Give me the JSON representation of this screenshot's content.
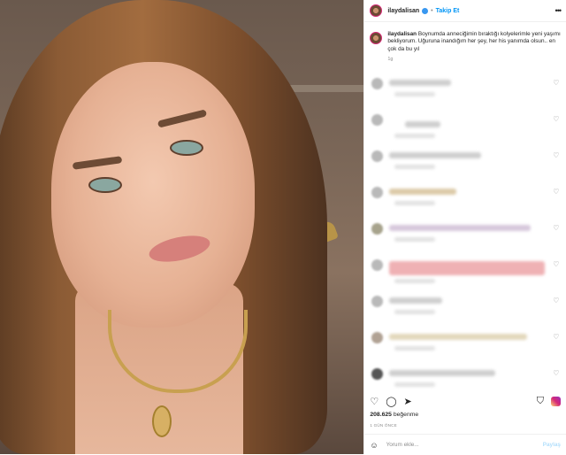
{
  "post": {
    "username": "ilaydalisan",
    "follow_label": "Takip Et",
    "more_icon": "more-horizontal-icon",
    "caption": "Boynumda anneciğimin bıraktığı kolyelerimle yeni yaşımı bekliyorum. Uğuruna inandığım her şey, her his yanımda olsun.. en çok da bu yıl",
    "caption_time": "1g",
    "likes_count": "208.625",
    "likes_label": "beğenme",
    "timestamp": "1 GÜN ÖNCE",
    "comment_placeholder": "Yorum ekle...",
    "post_button": "Paylaş",
    "colors": {
      "accent": "#0095f6",
      "verified": "#3897f0",
      "ring": "#d62976"
    }
  },
  "actions": {
    "like_icon": "heart-icon",
    "comment_icon": "comment-icon",
    "share_icon": "share-icon",
    "save_icon": "bookmark-icon",
    "logo_icon": "instagram-logo-icon",
    "emoji_icon": "smiley-icon"
  }
}
